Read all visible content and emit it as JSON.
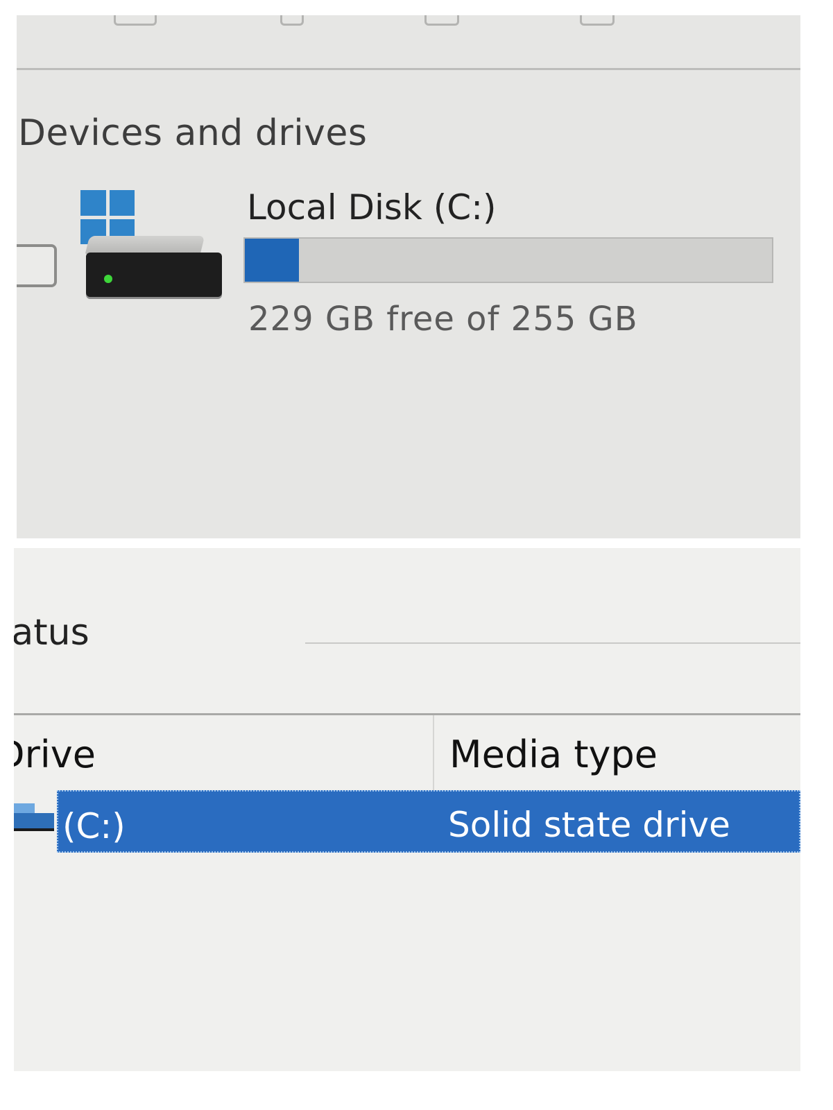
{
  "this_pc": {
    "section_title": "Devices and drives",
    "drive": {
      "name": "Local Disk (C:)",
      "free_text": "229 GB free of 255 GB",
      "used_fraction": 0.102,
      "bar_fill_color": "#1f66b6",
      "icon": "windows-drive-icon"
    }
  },
  "optimize": {
    "status_label": "tatus",
    "columns": {
      "drive": "Drive",
      "media_type": "Media type"
    },
    "rows": [
      {
        "drive": "(C:)",
        "media_type": "Solid state drive",
        "selected": true,
        "icon": "drive-icon"
      }
    ],
    "selection_color": "#2a6cc0"
  }
}
